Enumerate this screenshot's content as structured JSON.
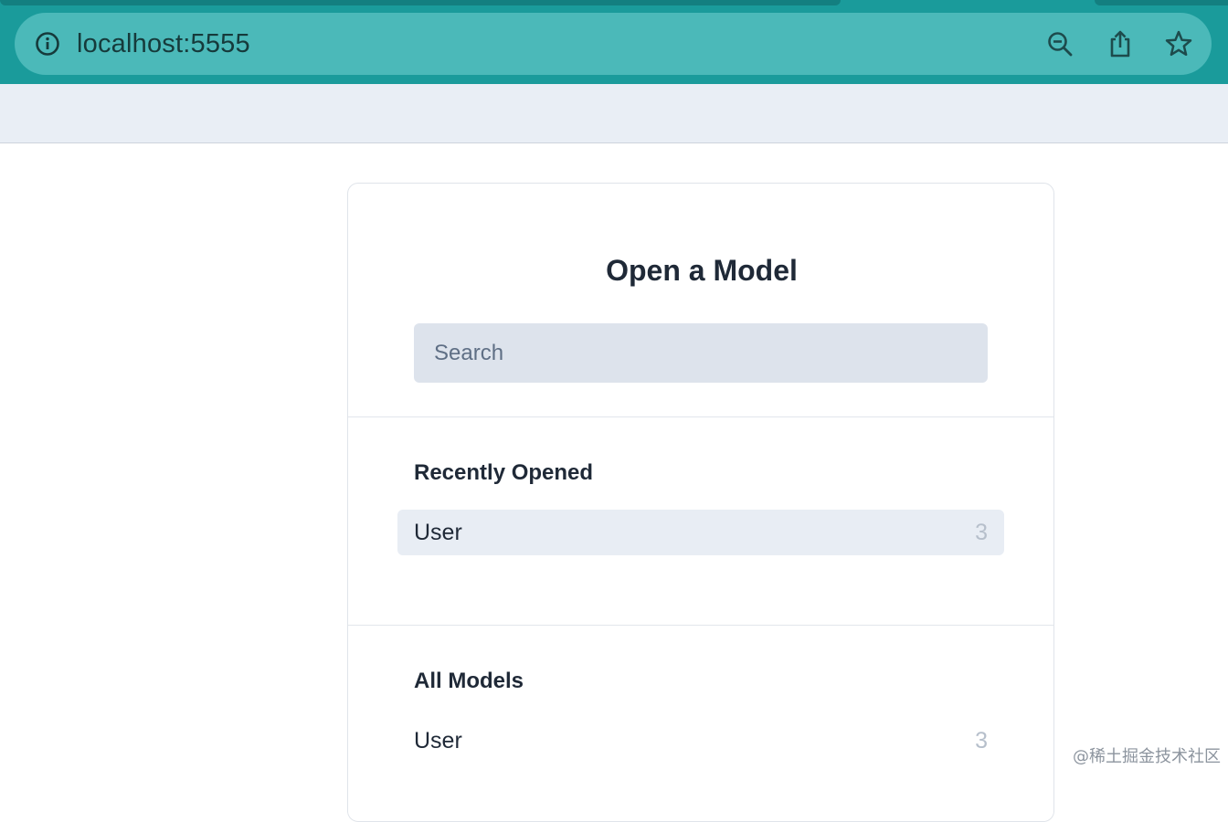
{
  "browser": {
    "url": "localhost:5555",
    "icons": {
      "site_info": "info-icon",
      "zoom": "zoom-out-icon",
      "share": "share-icon",
      "bookmark": "star-icon"
    },
    "colors": {
      "chrome": "#1a9b9b",
      "omnibox": "#4bb9b9"
    }
  },
  "dialog": {
    "title": "Open a Model",
    "search_placeholder": "Search",
    "recent": {
      "heading": "Recently Opened",
      "items": [
        {
          "name": "User",
          "count": "3"
        }
      ]
    },
    "all": {
      "heading": "All Models",
      "items": [
        {
          "name": "User",
          "count": "3"
        }
      ]
    }
  },
  "watermark": "@稀土掘金技术社区"
}
